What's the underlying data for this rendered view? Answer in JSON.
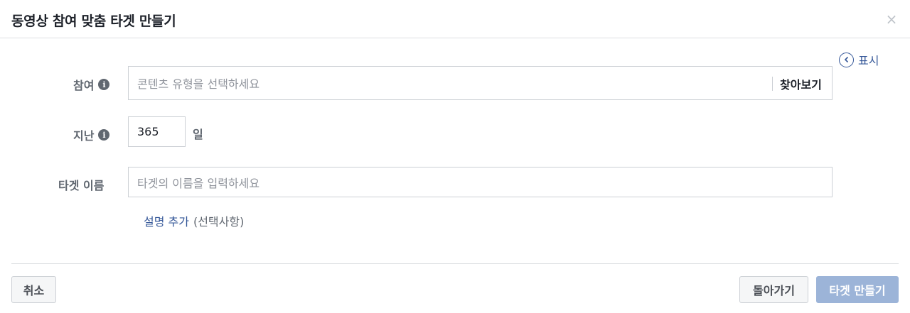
{
  "dialog": {
    "title": "동영상 참여 맞춤 타겟 만들기",
    "close_symbol": "×"
  },
  "show_link": {
    "icon": "chevron-left-circle-icon",
    "label": "표시"
  },
  "fields": {
    "engagement": {
      "label": "참여",
      "info_icon": "info-icon",
      "placeholder": "콘텐츠 유형을 선택하세요",
      "browse_label": "찾아보기"
    },
    "retention": {
      "label": "지난",
      "info_icon": "info-icon",
      "value": "365",
      "unit": "일"
    },
    "audience_name": {
      "label": "타겟 이름",
      "placeholder": "타겟의 이름을 입력하세요"
    }
  },
  "description": {
    "link": "설명 추가",
    "optional": "(선택사항)"
  },
  "footer": {
    "cancel_label": "취소",
    "back_label": "돌아가기",
    "create_label": "타겟 만들기"
  },
  "colors": {
    "link": "#365899",
    "primary_disabled": "#9cb4d8",
    "label": "#606770",
    "border": "#ccd0d5"
  }
}
